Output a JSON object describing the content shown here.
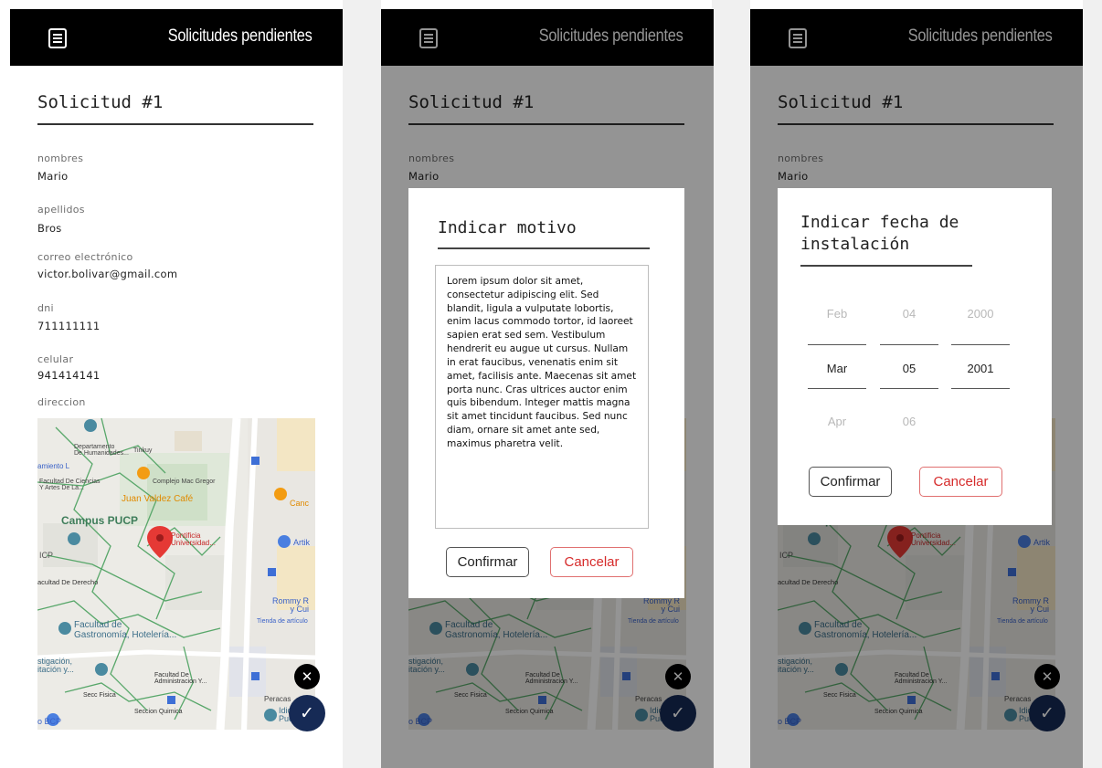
{
  "colors": {
    "appbar": "#000000",
    "fab_check": "#162a55",
    "cancel": "#d62b2b"
  },
  "appbar": {
    "menu_icon": "menu-icon",
    "title": "Solicitudes pendientes"
  },
  "request": {
    "title": "Solicitud #1"
  },
  "fields": [
    {
      "label": "nombres",
      "value": "Mario"
    },
    {
      "label": "apellidos",
      "value": "Bros"
    },
    {
      "label": "correo electrónico",
      "value": "victor.bolivar@gmail.com"
    },
    {
      "label": "dni",
      "value": "711111111"
    },
    {
      "label": "celular",
      "value": "941414141"
    },
    {
      "label": "direccion"
    }
  ],
  "map": {
    "labels": {
      "dept": "Departamento\nDe Humanidades...",
      "tinkuy": "Tinkuy",
      "miento": "amiento L",
      "fac_ciencias": "Facultad De Ciencias\nY Artes De La...",
      "mac_gregor": "Complejo Mac Gregor",
      "juan_valdez": "Juan Valdez Café",
      "canc": "Canc",
      "campus": "Campus PUCP",
      "pucp": "Pontificia\nUniversidad...",
      "artik": "Artik",
      "icp": "ICP",
      "derecho": "acultad De Derecho",
      "rommy": "Rommy R\ny Cui",
      "tienda": "Tienda de artículo",
      "gastronomia": "Facultad de\nGastronomía, Hotelería...",
      "investigacion": "stigación,\nitación y...",
      "administracion": "Facultad De\nAdministracion Y...",
      "fisica": "Secc Fisica",
      "peracas": "Peracas",
      "quimica": "Seccion Quimica",
      "bcp": "o BCP",
      "idio": "Idio\nPueb"
    }
  },
  "fab": {
    "close_icon": "close-icon",
    "check_icon": "check-icon",
    "close_glyph": "✕",
    "check_glyph": "✓"
  },
  "dialog_motivo": {
    "title": "Indicar motivo",
    "text": "Lorem ipsum dolor sit amet, consectetur adipiscing elit. Sed blandit, ligula a vulputate lobortis, enim lacus commodo tortor, id laoreet sapien erat sed sem. Vestibulum hendrerit eu augue ut cursus. Nullam in erat faucibus, venenatis enim sit amet, facilisis ante. Maecenas sit amet porta nunc. Cras ultrices auctor enim quis bibendum. Integer mattis magna sit amet tincidunt faucibus. Sed nunc diam, ornare sit amet ante sed, maximus pharetra velit.",
    "confirm": "Confirmar",
    "cancel": "Cancelar"
  },
  "dialog_fecha": {
    "title": "Indicar fecha de\ninstalación",
    "month": {
      "prev": "Feb",
      "selected": "Mar",
      "next": "Apr"
    },
    "day": {
      "prev": "04",
      "selected": "05",
      "next": "06"
    },
    "year": {
      "prev": "2000",
      "selected": "2001"
    },
    "confirm": "Confirmar",
    "cancel": "Cancelar"
  }
}
